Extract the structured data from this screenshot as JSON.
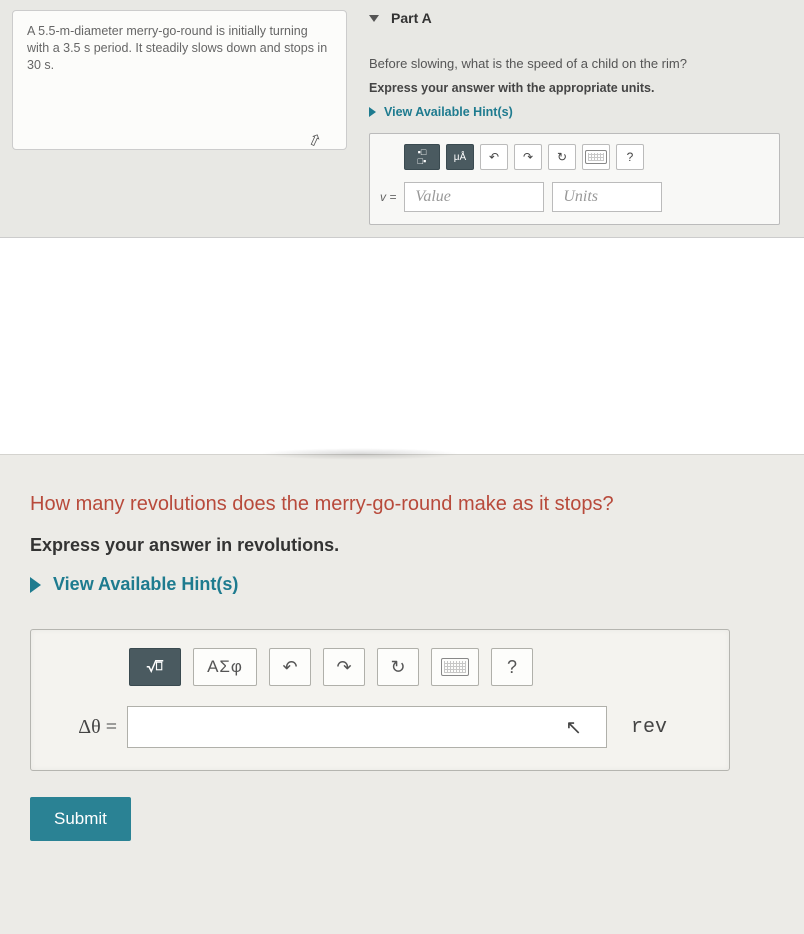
{
  "top": {
    "problem_text": "A 5.5-m-diameter merry-go-round is initially turning with a 3.5 s period. It steadily slows down and stops in 30 s.",
    "part_header": "Part A",
    "question": "Before slowing, what is the speed of a child on the rim?",
    "instruction": "Express your answer with the appropriate units.",
    "hint_label": "View Available Hint(s)",
    "var": "v =",
    "value_placeholder": "Value",
    "units_placeholder": "Units",
    "toolbar": {
      "format": "fmt",
      "units_tool": "μÅ",
      "undo": "↶",
      "redo": "↷",
      "refresh": "↻",
      "keyboard": "kbd",
      "help": "?"
    }
  },
  "bottom": {
    "question": "How many revolutions does the merry-go-round make as it stops?",
    "instruction": "Express your answer in revolutions.",
    "hint_label": "View Available Hint(s)",
    "var": "Δθ =",
    "unit": "rev",
    "toolbar": {
      "sqrt": "√x",
      "greek": "ΑΣφ",
      "undo": "↶",
      "redo": "↷",
      "refresh": "↻",
      "keyboard": "kbd",
      "help": "?"
    },
    "submit": "Submit"
  }
}
